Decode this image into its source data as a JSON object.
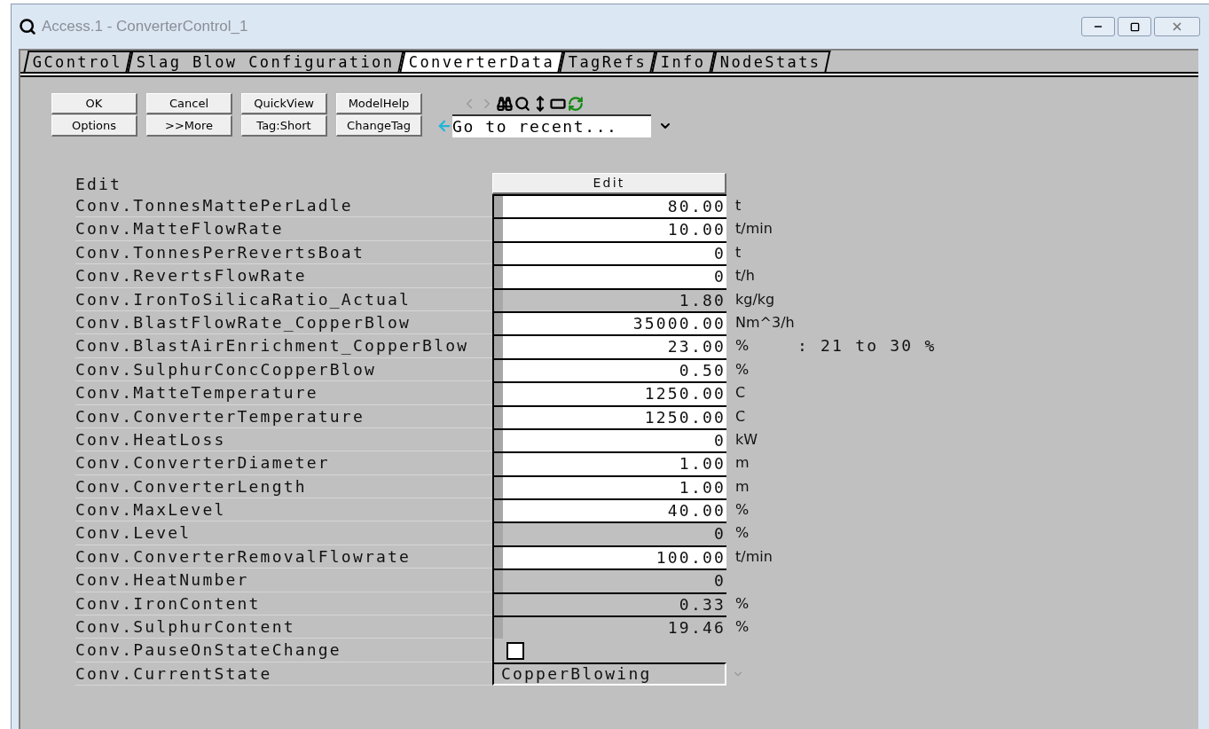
{
  "window": {
    "title": "Access.1 - ConverterControl_1"
  },
  "tabs": [
    {
      "label": "GControl",
      "selected": false
    },
    {
      "label": "Slag Blow Configuration",
      "selected": false
    },
    {
      "label": "ConverterData",
      "selected": true
    },
    {
      "label": "TagRefs",
      "selected": false
    },
    {
      "label": "Info",
      "selected": false
    },
    {
      "label": "NodeStats",
      "selected": false
    }
  ],
  "buttons": [
    {
      "label": "OK"
    },
    {
      "label": "Cancel"
    },
    {
      "label": "QuickView"
    },
    {
      "label": "ModelHelp"
    },
    {
      "label": "Options"
    },
    {
      "label": ">>More"
    },
    {
      "label": "Tag:Short"
    },
    {
      "label": "ChangeTag"
    }
  ],
  "toolbar": [
    {
      "kind": "back",
      "disabled": true
    },
    {
      "kind": "forward",
      "disabled": true
    },
    {
      "kind": "find",
      "disabled": false
    },
    {
      "kind": "zoom",
      "disabled": false
    },
    {
      "kind": "updown",
      "disabled": false
    },
    {
      "kind": "flag",
      "disabled": false
    },
    {
      "kind": "refresh",
      "disabled": false
    }
  ],
  "recent": {
    "value": "Go to recent..."
  },
  "table": {
    "label_header": "Edit",
    "value_header": "Edit",
    "rows": [
      {
        "kind": "number",
        "label": "Conv.TonnesMattePerLadle",
        "value": "80.00",
        "unit": "t",
        "editable": true
      },
      {
        "kind": "number",
        "label": "Conv.MatteFlowRate",
        "value": "10.00",
        "unit": "t/min",
        "editable": true
      },
      {
        "kind": "number",
        "label": "Conv.TonnesPerRevertsBoat",
        "value": "0",
        "unit": "t",
        "editable": true
      },
      {
        "kind": "number",
        "label": "Conv.RevertsFlowRate",
        "value": "0",
        "unit": "t/h",
        "editable": true
      },
      {
        "kind": "number",
        "label": "Conv.IronToSilicaRatio_Actual",
        "value": "1.80",
        "unit": "kg/kg",
        "editable": false
      },
      {
        "kind": "number",
        "label": "Conv.BlastFlowRate_CopperBlow",
        "value": "35000.00",
        "unit": "Nm^3/h",
        "editable": true
      },
      {
        "kind": "number",
        "label": "Conv.BlastAirEnrichment_CopperBlow",
        "value": "23.00",
        "unit": "%",
        "editable": true,
        "note": ": 21 to 30 %"
      },
      {
        "kind": "number",
        "label": "Conv.SulphurConcCopperBlow",
        "value": "0.50",
        "unit": "%",
        "editable": true
      },
      {
        "kind": "number",
        "label": "Conv.MatteTemperature",
        "value": "1250.00",
        "unit": "C",
        "editable": true
      },
      {
        "kind": "number",
        "label": "Conv.ConverterTemperature",
        "value": "1250.00",
        "unit": "C",
        "editable": true
      },
      {
        "kind": "number",
        "label": "Conv.HeatLoss",
        "value": "0",
        "unit": "kW",
        "editable": true
      },
      {
        "kind": "number",
        "label": "Conv.ConverterDiameter",
        "value": "1.00",
        "unit": "m",
        "editable": true
      },
      {
        "kind": "number",
        "label": "Conv.ConverterLength",
        "value": "1.00",
        "unit": "m",
        "editable": true
      },
      {
        "kind": "number",
        "label": "Conv.MaxLevel",
        "value": "40.00",
        "unit": "%",
        "editable": true
      },
      {
        "kind": "number",
        "label": "Conv.Level",
        "value": "0",
        "unit": "%",
        "editable": false
      },
      {
        "kind": "number",
        "label": "Conv.ConverterRemovalFlowrate",
        "value": "100.00",
        "unit": "t/min",
        "editable": true
      },
      {
        "kind": "number",
        "label": "Conv.HeatNumber",
        "value": "0",
        "editable": false
      },
      {
        "kind": "number",
        "label": "Conv.IronContent",
        "value": "0.33",
        "unit": "%",
        "editable": false
      },
      {
        "kind": "number",
        "label": "Conv.SulphurContent",
        "value": "19.46",
        "unit": "%",
        "editable": false
      },
      {
        "kind": "checkbox",
        "label": "Conv.PauseOnStateChange",
        "checked": false
      },
      {
        "kind": "select",
        "label": "Conv.CurrentState",
        "value": "CopperBlowing"
      }
    ]
  }
}
